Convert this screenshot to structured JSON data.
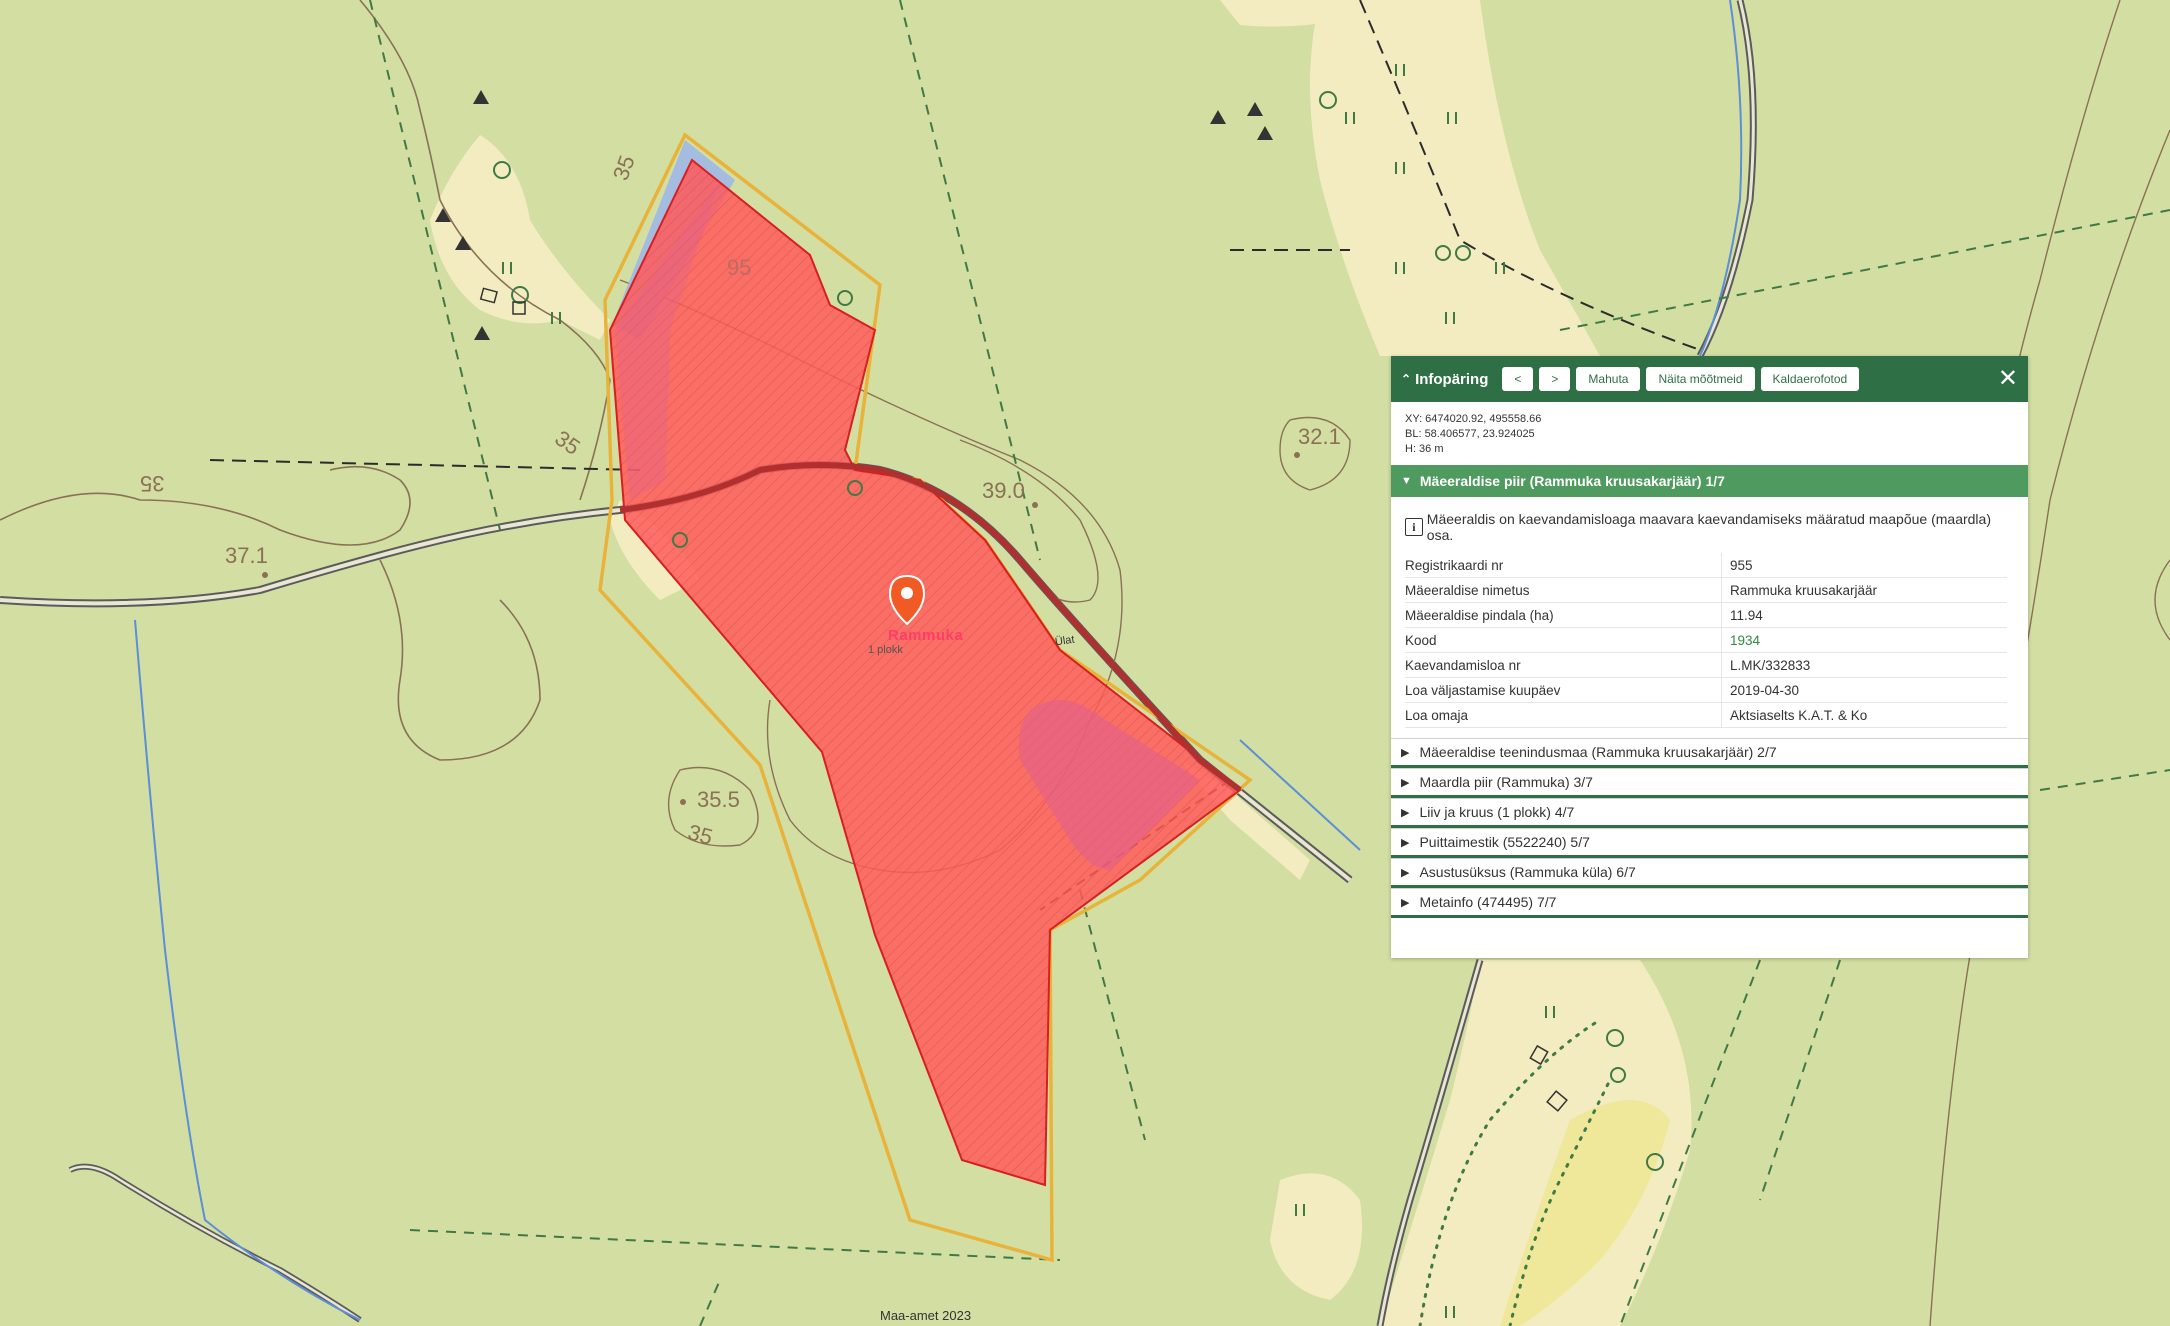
{
  "map": {
    "labels": {
      "contour_35_a": "35",
      "contour_35_b": "35",
      "contour_35_c": "35",
      "contour_35_d": "35",
      "height_371": "37.1",
      "height_390": "39.0",
      "height_355": "35.5",
      "height_321": "32.1",
      "pit_label": "95"
    },
    "marker": {
      "label": "Rammuka",
      "sublabel": "1 plokk"
    },
    "road_label": "Ülat",
    "copyright": "Maa-amet 2023",
    "colors": {
      "background": "#d3dea3",
      "open_area": "#f3ecc1",
      "polygon_fill": "#ff5a5a",
      "polygon_outline": "#e8b33a"
    }
  },
  "panel": {
    "title": "Infopäring",
    "buttons": {
      "prev": "<",
      "next": ">",
      "fit": "Mahuta",
      "measure": "Näita mõõtmeid",
      "oblique": "Kaldaerofotod"
    },
    "coords": {
      "xy": "XY: 6474020.92, 495558.66",
      "bl": "BL: 58.406577, 23.924025",
      "h": "H: 36 m"
    },
    "open_section": {
      "title": "Mäeeraldise piir (Rammuka kruusakarjäär) 1/7",
      "description": "Mäeeraldis on kaevandamisloaga maavara kaevandamiseks määratud maapõue (maardla) osa.",
      "rows": [
        {
          "key": "Registrikaardi nr",
          "value": "955"
        },
        {
          "key": "Mäeeraldise nimetus",
          "value": "Rammuka kruusakarjäär"
        },
        {
          "key": "Mäeeraldise pindala (ha)",
          "value": "11.94"
        },
        {
          "key": "Kood",
          "value": "1934"
        },
        {
          "key": "Kaevandamisloa nr",
          "value": "L.MK/332833"
        },
        {
          "key": "Loa väljastamise kuupäev",
          "value": "2019-04-30"
        },
        {
          "key": "Loa omaja",
          "value": "Aktsiaselts K.A.T. & Ko"
        }
      ]
    },
    "sections": [
      "Mäeeraldise teenindusmaa (Rammuka kruusakarjäär) 2/7",
      "Maardla piir (Rammuka) 3/7",
      "Liiv ja kruus (1 plokk) 4/7",
      "Puittaimestik (5522240) 5/7",
      "Asustusüksus (Rammuka küla) 6/7",
      "Metainfo (474495) 7/7"
    ],
    "colors": {
      "header": "#2f6f45",
      "open_section": "#4f9a5e",
      "link": "#2f8a3e"
    }
  }
}
